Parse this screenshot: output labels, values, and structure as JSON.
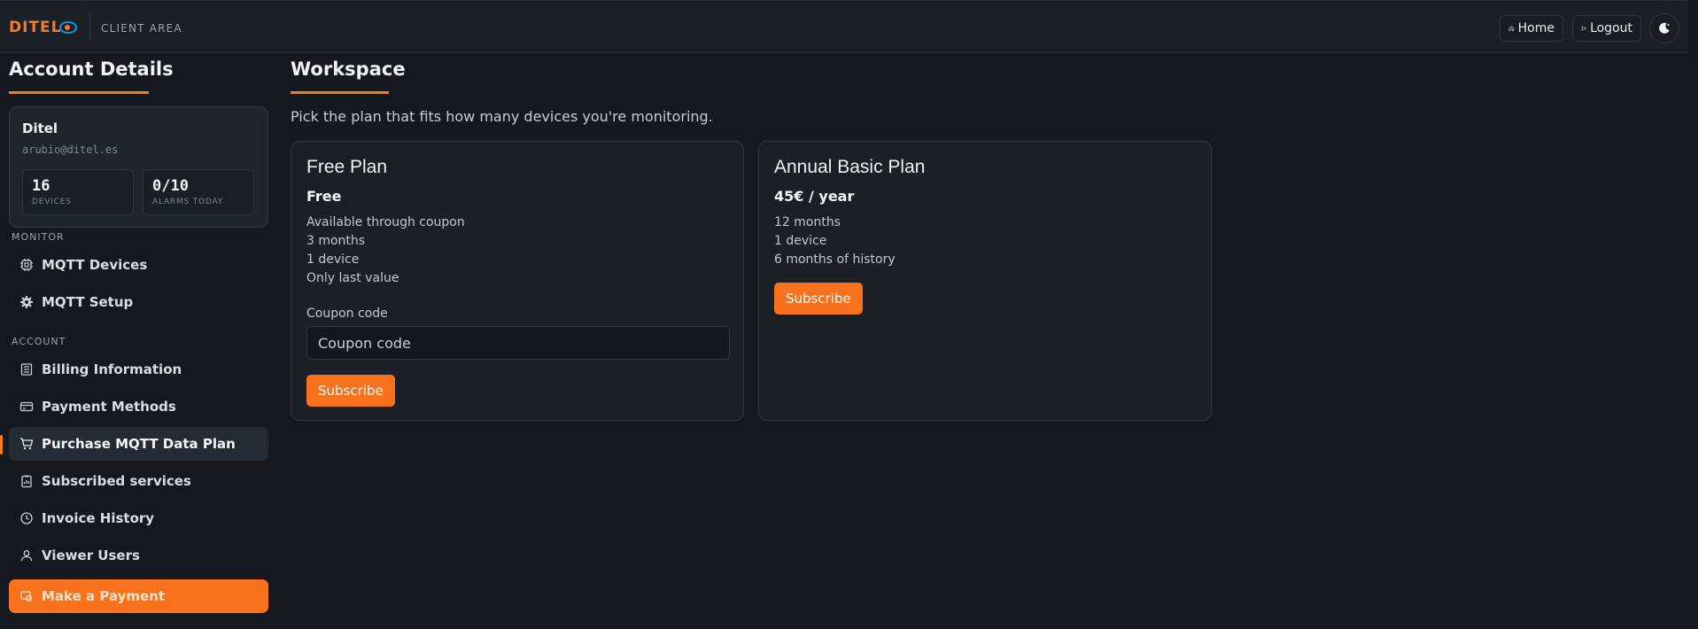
{
  "header": {
    "logo_text": "DITEL",
    "area_label": "CLIENT AREA",
    "home_label": "Home",
    "logout_label": "Logout"
  },
  "sidebar": {
    "title": "Account Details",
    "account": {
      "name": "Ditel",
      "email": "arubio@ditel.es",
      "devices_value": "16",
      "devices_label": "DEVICES",
      "alarms_value": "0/10",
      "alarms_label": "ALARMS TODAY"
    },
    "monitor_label": "MONITOR",
    "monitor_items": [
      {
        "label": "MQTT Devices",
        "icon": "chip-icon"
      },
      {
        "label": "MQTT Setup",
        "icon": "gear-icon"
      }
    ],
    "account_label": "ACCOUNT",
    "account_items": [
      {
        "label": "Billing Information",
        "icon": "document-icon"
      },
      {
        "label": "Payment Methods",
        "icon": "credit-card-icon"
      },
      {
        "label": "Purchase MQTT Data Plan",
        "icon": "cart-icon",
        "active": true
      },
      {
        "label": "Subscribed services",
        "icon": "clipboard-icon"
      },
      {
        "label": "Invoice History",
        "icon": "clock-icon"
      },
      {
        "label": "Viewer Users",
        "icon": "user-icon"
      }
    ],
    "payment_button": "Make a Payment"
  },
  "main": {
    "title": "Workspace",
    "subtitle": "Pick the plan that fits how many devices you're monitoring.",
    "plans": [
      {
        "name": "Free Plan",
        "price": "Free",
        "features": [
          "Available through coupon",
          "3 months",
          "1 device",
          "Only last value"
        ],
        "coupon_label": "Coupon code",
        "coupon_placeholder": "Coupon code",
        "button": "Subscribe"
      },
      {
        "name": "Annual Basic Plan",
        "price": "45€ / year",
        "features": [
          "12 months",
          "1 device",
          "6 months of history"
        ],
        "button": "Subscribe"
      }
    ]
  },
  "colors": {
    "accent": "#f57c20",
    "background": "#15181e",
    "panel": "#1b1f26"
  }
}
